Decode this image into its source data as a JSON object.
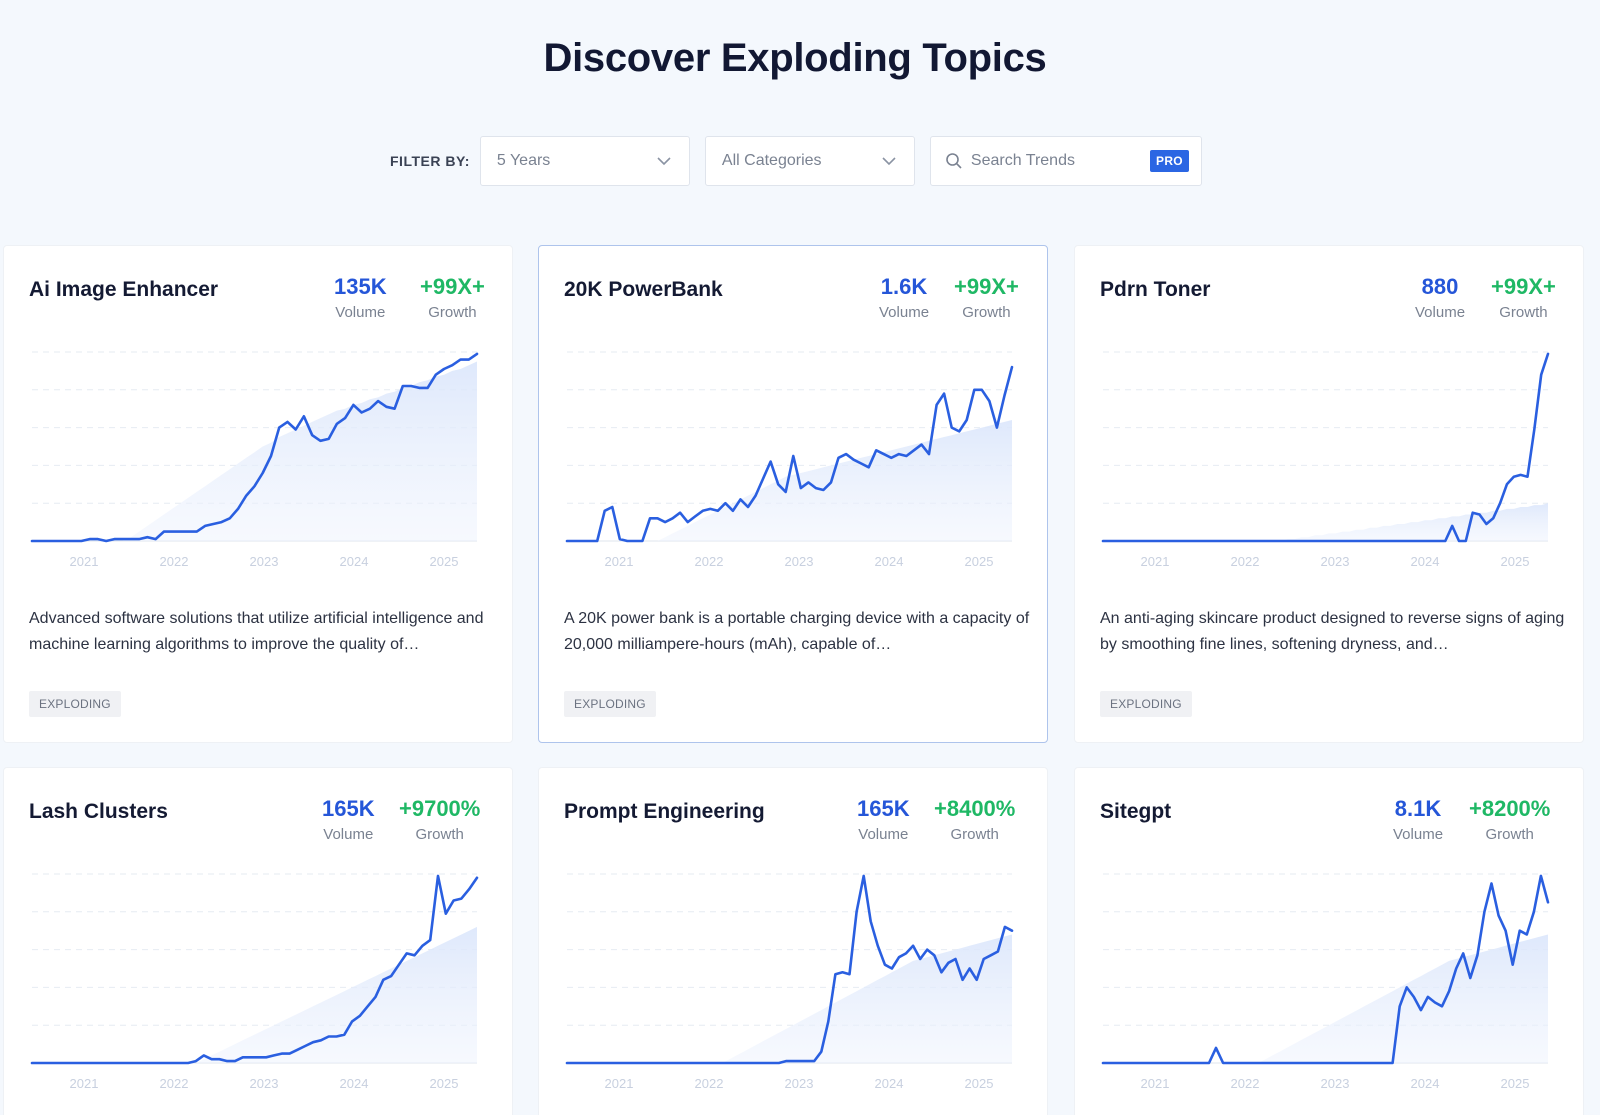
{
  "page": {
    "title": "Discover Exploding Topics"
  },
  "filters": {
    "label": "FILTER BY:",
    "timeframe": "5 Years",
    "category": "All Categories",
    "search_placeholder": "Search Trends",
    "pro_badge": "PRO"
  },
  "colors": {
    "accent_blue": "#2556d8",
    "growth_green": "#1fb865",
    "background": "#f4f8fd"
  },
  "cards": [
    {
      "title": "Ai Image Enhancer",
      "volume": "135K",
      "volume_label": "Volume",
      "growth": "+99X+",
      "growth_label": "Growth",
      "description": "Advanced software solutions that utilize artificial intelligence and machine learning algorithms to improve the quality of…",
      "tag": "EXPLODING"
    },
    {
      "title": "20K PowerBank",
      "volume": "1.6K",
      "volume_label": "Volume",
      "growth": "+99X+",
      "growth_label": "Growth",
      "description": "A 20K power bank is a portable charging device with a capacity of 20,000 milliampere-hours (mAh), capable of…",
      "tag": "EXPLODING"
    },
    {
      "title": "Pdrn Toner",
      "volume": "880",
      "volume_label": "Volume",
      "growth": "+99X+",
      "growth_label": "Growth",
      "description": "An anti-aging skincare product designed to reverse signs of aging by smoothing fine lines, softening dryness, and…",
      "tag": "EXPLODING"
    },
    {
      "title": "Lash Clusters",
      "volume": "165K",
      "volume_label": "Volume",
      "growth": "+9700%",
      "growth_label": "Growth",
      "description": "",
      "tag": ""
    },
    {
      "title": "Prompt Engineering",
      "volume": "165K",
      "volume_label": "Volume",
      "growth": "+8400%",
      "growth_label": "Growth",
      "description": "",
      "tag": ""
    },
    {
      "title": "Sitegpt",
      "volume": "8.1K",
      "volume_label": "Volume",
      "growth": "+8200%",
      "growth_label": "Growth",
      "description": "",
      "tag": ""
    }
  ],
  "chart_data": [
    {
      "type": "line",
      "title": "Ai Image Enhancer",
      "x_ticks": [
        "2021",
        "2022",
        "2023",
        "2024",
        "2025"
      ],
      "ylim": [
        0,
        100
      ],
      "grid": true,
      "series": [
        {
          "values": [
            0,
            0,
            0,
            0,
            0,
            0,
            0,
            1,
            1,
            0,
            1,
            1,
            1,
            1,
            2,
            1,
            5,
            5,
            5,
            5,
            5,
            8,
            9,
            10,
            12,
            17,
            24,
            29,
            36,
            45,
            60,
            63,
            59,
            66,
            56,
            53,
            54,
            62,
            65,
            72,
            68,
            70,
            74,
            71,
            70,
            82,
            82,
            81,
            81,
            88,
            91,
            93,
            96,
            96,
            99
          ]
        }
      ],
      "trend": [
        0,
        0,
        0,
        0,
        0,
        0,
        0,
        0,
        0,
        0,
        0,
        0,
        2,
        5,
        8,
        11,
        14,
        17,
        20,
        23,
        26,
        29,
        32,
        35,
        38,
        41,
        44,
        47,
        50,
        52,
        55,
        57,
        59,
        61,
        63,
        65,
        67,
        69,
        70,
        72,
        73,
        75,
        76,
        78,
        79,
        81,
        82,
        84,
        85,
        87,
        88,
        90,
        91,
        93,
        95
      ]
    },
    {
      "type": "line",
      "title": "20K PowerBank",
      "x_ticks": [
        "2021",
        "2022",
        "2023",
        "2024",
        "2025"
      ],
      "ylim": [
        0,
        100
      ],
      "grid": true,
      "series": [
        {
          "values": [
            0,
            0,
            0,
            0,
            0,
            16,
            18,
            1,
            0,
            0,
            0,
            12,
            12,
            10,
            12,
            15,
            10,
            13,
            16,
            17,
            16,
            20,
            16,
            22,
            18,
            24,
            33,
            42,
            30,
            26,
            45,
            28,
            31,
            28,
            27,
            31,
            44,
            46,
            43,
            41,
            39,
            48,
            46,
            44,
            46,
            45,
            48,
            51,
            46,
            72,
            78,
            60,
            58,
            64,
            80,
            80,
            74,
            60,
            77,
            92
          ]
        }
      ],
      "trend": [
        0,
        0,
        0,
        0,
        0,
        0,
        0,
        0,
        0,
        0,
        0,
        0,
        0,
        2,
        4,
        6,
        8,
        10,
        12,
        14,
        16,
        18,
        20,
        22,
        24,
        26,
        28,
        30,
        32,
        34,
        35,
        36,
        37,
        38,
        39,
        40,
        41,
        42,
        43,
        44,
        45,
        46,
        47,
        48,
        49,
        50,
        51,
        52,
        53,
        54,
        55,
        56,
        57,
        58,
        59,
        60,
        61,
        62,
        63,
        64
      ]
    },
    {
      "type": "line",
      "title": "Pdrn Toner",
      "x_ticks": [
        "2021",
        "2022",
        "2023",
        "2024",
        "2025"
      ],
      "ylim": [
        0,
        100
      ],
      "grid": true,
      "series": [
        {
          "values": [
            0,
            0,
            0,
            0,
            0,
            0,
            0,
            0,
            0,
            0,
            0,
            0,
            0,
            0,
            0,
            0,
            0,
            0,
            0,
            0,
            0,
            0,
            0,
            0,
            0,
            0,
            0,
            0,
            0,
            0,
            0,
            0,
            0,
            0,
            0,
            0,
            0,
            0,
            0,
            0,
            0,
            0,
            0,
            0,
            0,
            0,
            0,
            0,
            0,
            0,
            0,
            8,
            0,
            0,
            15,
            14,
            9,
            12,
            20,
            30,
            34,
            35,
            34,
            59,
            88,
            99
          ]
        }
      ],
      "trend": [
        0,
        0,
        0,
        0,
        0,
        0,
        0,
        0,
        0,
        0,
        0,
        0,
        0,
        0,
        0,
        0,
        0,
        0,
        0,
        0,
        0,
        0,
        0,
        0,
        0,
        0,
        0,
        1,
        1,
        2,
        2,
        3,
        3,
        4,
        4,
        5,
        5,
        6,
        6,
        7,
        7,
        8,
        8,
        9,
        9,
        10,
        10,
        11,
        11,
        12,
        12,
        13,
        13,
        14,
        14,
        15,
        15,
        16,
        16,
        17,
        17,
        18,
        18,
        19,
        19,
        20
      ]
    },
    {
      "type": "line",
      "title": "Lash Clusters",
      "x_ticks": [
        "2021",
        "2022",
        "2023",
        "2024",
        "2025"
      ],
      "ylim": [
        0,
        100
      ],
      "grid": true,
      "series": [
        {
          "values": [
            0,
            0,
            0,
            0,
            0,
            0,
            0,
            0,
            0,
            0,
            0,
            0,
            0,
            0,
            0,
            0,
            0,
            0,
            0,
            0,
            0,
            1,
            4,
            2,
            2,
            1,
            1,
            3,
            3,
            3,
            3,
            4,
            5,
            5,
            7,
            9,
            11,
            12,
            14,
            14,
            15,
            22,
            25,
            30,
            35,
            44,
            46,
            52,
            58,
            57,
            62,
            65,
            99,
            79,
            86,
            87,
            92,
            98
          ]
        }
      ],
      "trend": [
        0,
        0,
        0,
        0,
        0,
        0,
        0,
        0,
        0,
        0,
        0,
        0,
        0,
        0,
        0,
        0,
        0,
        0,
        0,
        0,
        0,
        0,
        2,
        4,
        6,
        8,
        10,
        12,
        14,
        16,
        18,
        20,
        22,
        24,
        26,
        28,
        30,
        32,
        34,
        36,
        38,
        40,
        42,
        44,
        46,
        48,
        50,
        52,
        54,
        56,
        58,
        60,
        62,
        64,
        66,
        68,
        70,
        72
      ]
    },
    {
      "type": "line",
      "title": "Prompt Engineering",
      "x_ticks": [
        "2021",
        "2022",
        "2023",
        "2024",
        "2025"
      ],
      "ylim": [
        0,
        100
      ],
      "grid": true,
      "series": [
        {
          "values": [
            0,
            0,
            0,
            0,
            0,
            0,
            0,
            0,
            0,
            0,
            0,
            0,
            0,
            0,
            0,
            0,
            0,
            0,
            0,
            0,
            0,
            0,
            0,
            0,
            0,
            0,
            0,
            0,
            0,
            0,
            0,
            1,
            1,
            1,
            1,
            1,
            6,
            22,
            47,
            48,
            47,
            80,
            99,
            75,
            62,
            52,
            50,
            56,
            58,
            62,
            55,
            60,
            57,
            48,
            53,
            55,
            44,
            50,
            44,
            55,
            57,
            59,
            72,
            70
          ]
        }
      ],
      "trend": [
        0,
        0,
        0,
        0,
        0,
        0,
        0,
        0,
        0,
        0,
        0,
        0,
        0,
        0,
        0,
        0,
        0,
        0,
        0,
        0,
        0,
        0,
        0,
        2,
        4,
        6,
        8,
        10,
        12,
        14,
        16,
        18,
        20,
        22,
        24,
        26,
        28,
        30,
        32,
        34,
        36,
        38,
        40,
        42,
        44,
        46,
        48,
        50,
        52,
        54,
        55,
        56,
        57,
        58,
        59,
        60,
        61,
        62,
        63,
        64,
        65,
        66,
        67,
        68
      ]
    },
    {
      "type": "line",
      "title": "Sitegpt",
      "x_ticks": [
        "2021",
        "2022",
        "2023",
        "2024",
        "2025"
      ],
      "ylim": [
        0,
        100
      ],
      "grid": true,
      "series": [
        {
          "values": [
            0,
            0,
            0,
            0,
            0,
            0,
            0,
            0,
            0,
            0,
            0,
            0,
            0,
            0,
            0,
            0,
            8,
            0,
            0,
            0,
            0,
            0,
            0,
            0,
            0,
            0,
            0,
            0,
            0,
            0,
            0,
            0,
            0,
            0,
            0,
            0,
            0,
            0,
            0,
            0,
            0,
            0,
            30,
            40,
            35,
            28,
            35,
            32,
            30,
            38,
            50,
            58,
            45,
            57,
            80,
            95,
            78,
            70,
            52,
            70,
            68,
            80,
            99,
            85
          ]
        }
      ],
      "trend": [
        0,
        0,
        0,
        0,
        0,
        0,
        0,
        0,
        0,
        0,
        0,
        0,
        0,
        0,
        0,
        0,
        0,
        0,
        0,
        0,
        0,
        0,
        0,
        2,
        4,
        6,
        8,
        10,
        12,
        14,
        16,
        18,
        20,
        22,
        24,
        26,
        28,
        30,
        32,
        34,
        36,
        38,
        40,
        42,
        44,
        46,
        48,
        50,
        52,
        54,
        55,
        56,
        57,
        58,
        59,
        60,
        61,
        62,
        63,
        64,
        65,
        66,
        67,
        68
      ]
    }
  ]
}
